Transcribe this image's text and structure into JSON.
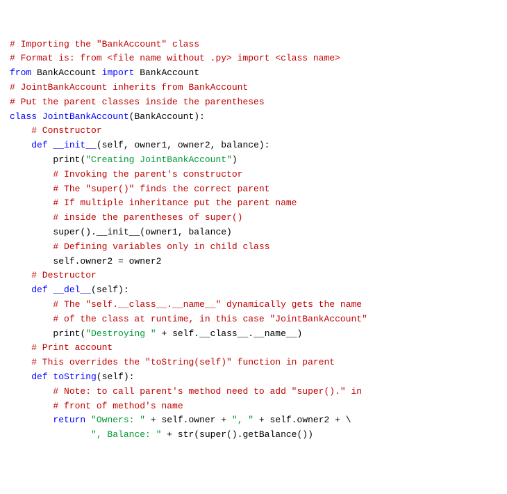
{
  "code": {
    "l1": "# Importing the \"BankAccount\" class",
    "l2": "# Format is: from <file name without .py> import <class name>",
    "l3_from": "from",
    "l3_mod": " BankAccount ",
    "l3_import": "import",
    "l3_cls": " BankAccount",
    "l4": "",
    "l5": "# JointBankAccount inherits from BankAccount",
    "l6": "# Put the parent classes inside the parentheses",
    "l7_class": "class",
    "l7_name": " JointBankAccount",
    "l7_paren_open": "(",
    "l7_parent": "BankAccount",
    "l7_paren_close": "):",
    "l8": "",
    "l9": "    # Constructor",
    "l10_indent": "    ",
    "l10_def": "def",
    "l10_name": " __init__",
    "l10_rest": "(self, owner1, owner2, balance):",
    "l11_indent": "        ",
    "l11_print": "print",
    "l11_po": "(",
    "l11_str": "\"Creating JointBankAccount\"",
    "l11_pc": ")",
    "l12": "        # Invoking the parent's constructor",
    "l13": "        # The \"super()\" finds the correct parent",
    "l14": "        # If multiple inheritance put the parent name",
    "l15": "        # inside the parentheses of super()",
    "l16": "        super().__init__(owner1, balance)",
    "l17": "        # Defining variables only in child class",
    "l18": "        self.owner2 = owner2",
    "l19": "",
    "l20": "    # Destructor",
    "l21_indent": "    ",
    "l21_def": "def",
    "l21_name": " __del__",
    "l21_rest": "(self):",
    "l22": "        # The \"self.__class__.__name__\" dynamically gets the name",
    "l23": "        # of the class at runtime, in this case \"JointBankAccount\"",
    "l24_indent": "        ",
    "l24_print": "print",
    "l24_po": "(",
    "l24_str": "\"Destroying \"",
    "l24_rest": " + self.__class__.__name__)",
    "l25": "",
    "l26": "    # Print account",
    "l27": "    # This overrides the \"toString(self)\" function in parent",
    "l28_indent": "    ",
    "l28_def": "def",
    "l28_name": " toString",
    "l28_rest": "(self):",
    "l29": "        # Note: to call parent's method need to add \"super().\" in",
    "l30": "        # front of method's name",
    "l31_indent": "        ",
    "l31_return": "return",
    "l31_sp": " ",
    "l31_str1": "\"Owners: \"",
    "l31_plus1": " + self.owner + ",
    "l31_str2": "\", \"",
    "l31_plus2": " + self.owner2 + \\",
    "l32_indent": "               ",
    "l32_str": "\", Balance: \"",
    "l32_rest": " + str(super().getBalance())"
  }
}
